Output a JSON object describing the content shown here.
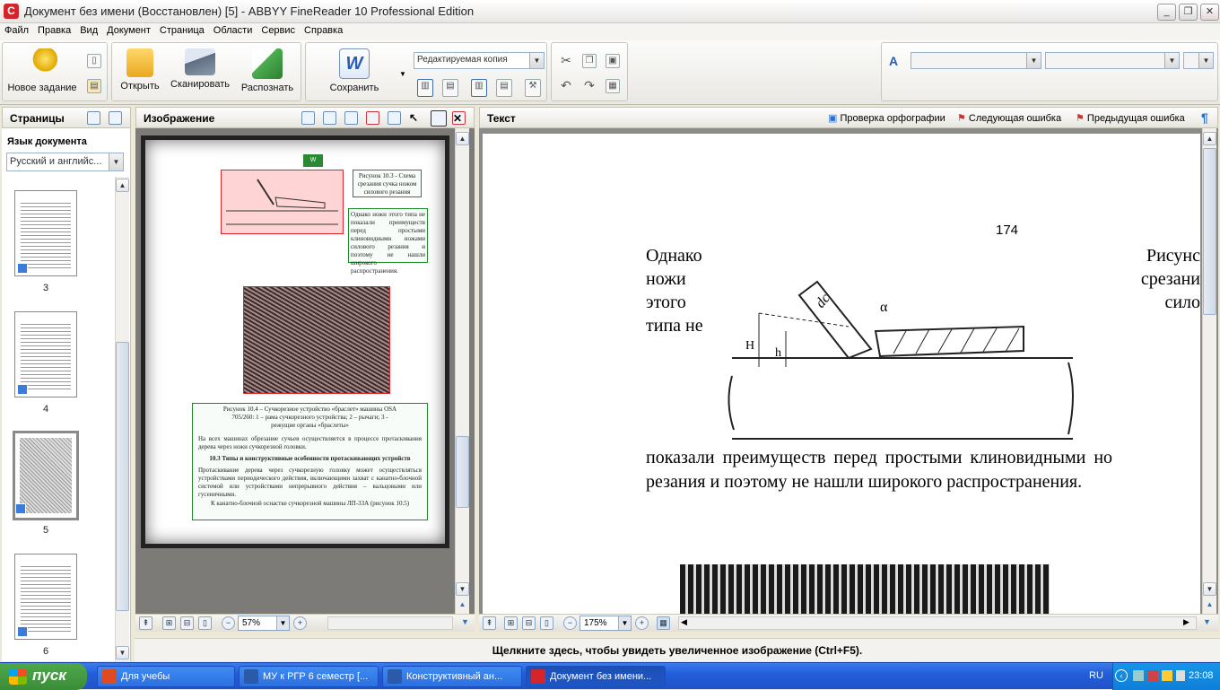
{
  "window": {
    "title": "Документ без имени (Восстановлен) [5] - ABBYY FineReader 10 Professional Edition"
  },
  "menu": [
    "Файл",
    "Правка",
    "Вид",
    "Документ",
    "Страница",
    "Области",
    "Сервис",
    "Справка"
  ],
  "toolbar": {
    "new_task": "Новое задание",
    "open": "Открыть",
    "scan": "Сканировать",
    "recognize": "Распознать",
    "save": "Сохранить",
    "format_mode": "Редактируемая копия"
  },
  "pages_pane": {
    "title": "Страницы",
    "language_label": "Язык документа",
    "language_value": "Русский и английс...",
    "page_numbers": [
      "3",
      "4",
      "5",
      "6"
    ],
    "selected_page": "5"
  },
  "image_pane": {
    "title": "Изображение",
    "zoom": "57%",
    "figure1_caption": "Рисунок 10.3 - Схема срезания сучка ножом силового резания",
    "paragraph1": "Однако ножи этого типа не показали преимуществ перед простыми клиновидными ножами силового резания и поэтому не нашли широкого распространения.",
    "figure2_caption": "Рисунок 10.4 – Сучкорезное устройство «браслет» машины OSA 705/260: 1 – рама сучкорезного устройства; 2 – рычаги; 3 - режущие органы «браслеты»",
    "paragraph2": "На всех машинах обрезание сучьев осуществляется в процессе протаскивания дерева через ножи сучкорезной головки.",
    "heading": "10.3 Типы и конструктивные особенности протаскивающих устройств",
    "paragraph3": "Протаскивание дерева через сучкорезную головку может осуществляться устройствами периодического действия, включающими захват с канатно-блочной системой или устройствами непрерывного действия – вальцовыми или гусеничными.",
    "paragraph4": "К канатно-блочной оснастке сучкорезной машины ЛП-33А (рисунок 10.5)"
  },
  "text_pane": {
    "title": "Текст",
    "spellcheck": "Проверка орфографии",
    "next_error": "Следующая ошибка",
    "prev_error": "Предыдущая ошибка",
    "zoom": "175%",
    "page_number": "174",
    "left_col": [
      "Однако",
      "ножи",
      "этого",
      "типа   не"
    ],
    "right_col": [
      "Рисунс",
      "срезани",
      "сило"
    ],
    "line1": "показали  преимуществ  перед  простыми  клиновидными  но",
    "line2": "резания и поэтому не нашли широкого распространения."
  },
  "statusbar": {
    "message": "Щелкните здесь, чтобы увидеть увеличенное изображение (Ctrl+F5)."
  },
  "taskbar": {
    "start": "пуск",
    "tasks": [
      "Для учебы",
      "МУ к РГР 6 семестр [...",
      "Конструктивный ан...",
      "Документ без имени..."
    ],
    "lang": "RU",
    "time": "23:08"
  }
}
